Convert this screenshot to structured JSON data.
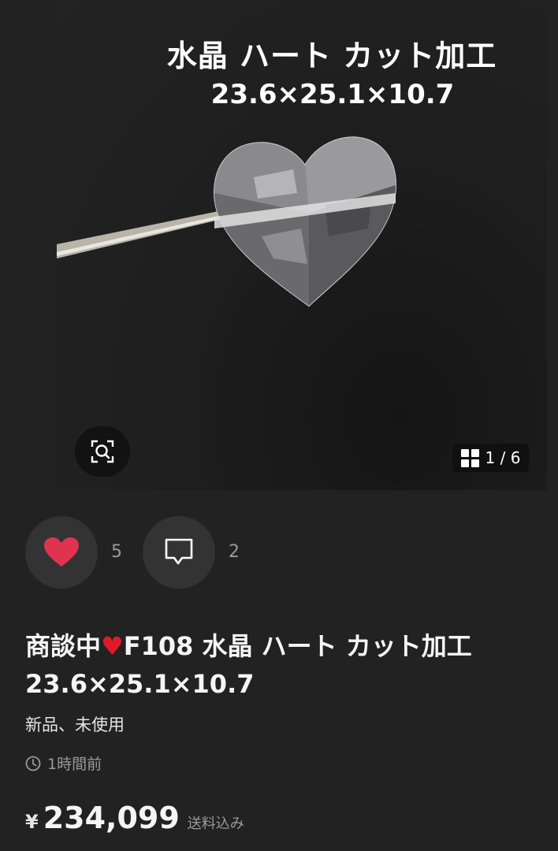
{
  "photo": {
    "caption_line1": "水晶 ハート カット加工",
    "caption_line2": "23.6×25.1×10.7",
    "counter": "1 / 6"
  },
  "icons": {
    "zoom": "zoom-search-icon",
    "gallery": "grid-icon",
    "like": "heart-icon",
    "comment": "comment-bubble-icon",
    "time": "clock-icon"
  },
  "actions": {
    "like_count": "5",
    "comment_count": "2"
  },
  "item": {
    "status": "商談中",
    "title_rest": "F108 水晶 ハート カット加工",
    "title_line2": "23.6×25.1×10.7",
    "condition": "新品、未使用",
    "posted": "1時間前",
    "currency": "¥",
    "price": "234,099",
    "shipping": "送料込み"
  },
  "colors": {
    "background": "#222222",
    "heart": "#e0334f",
    "circle": "#333333"
  }
}
